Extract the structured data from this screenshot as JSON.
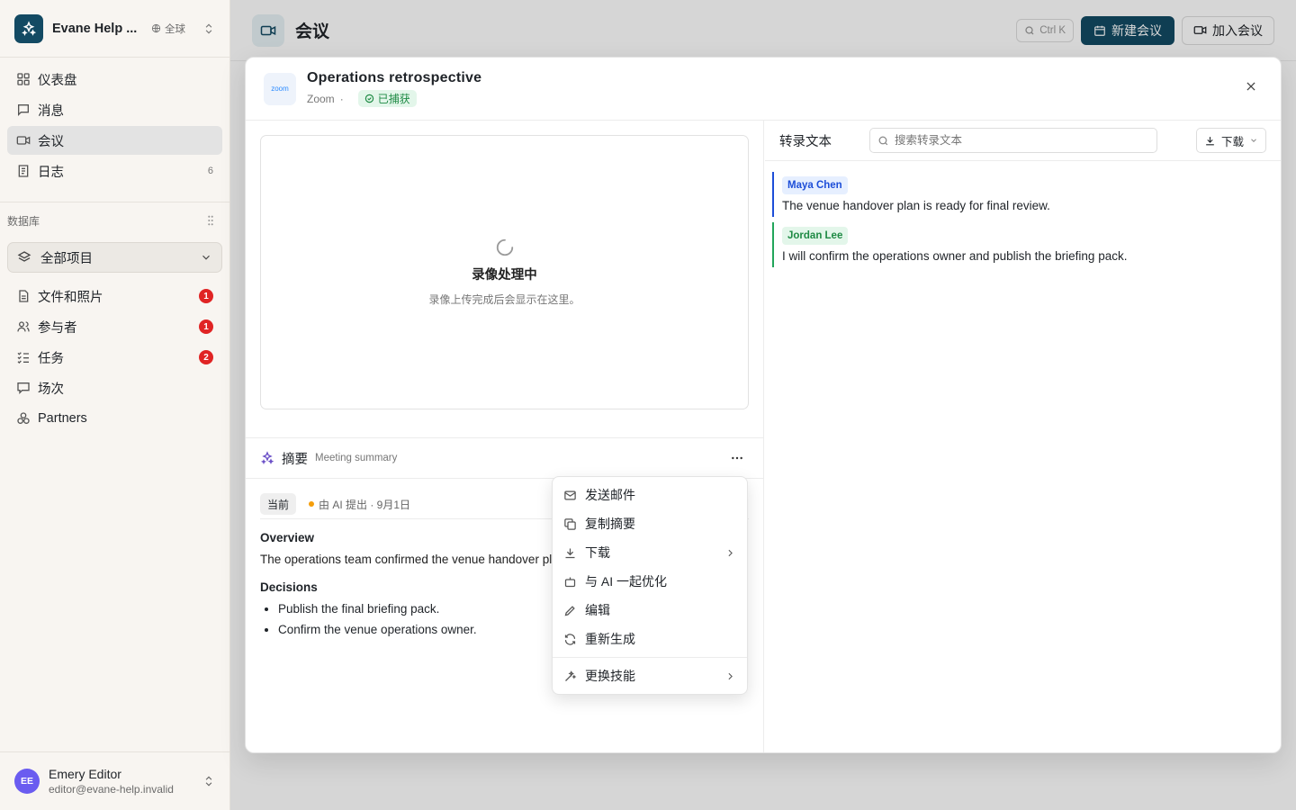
{
  "workspace": {
    "name": "Evane Help ...",
    "scope": "全球"
  },
  "nav": [
    {
      "label": "仪表盘",
      "icon": "dashboard-icon"
    },
    {
      "label": "消息",
      "icon": "message-icon"
    },
    {
      "label": "会议",
      "icon": "video-icon",
      "active": true
    },
    {
      "label": "日志",
      "icon": "log-icon",
      "count": "6"
    }
  ],
  "database": {
    "heading": "数据库",
    "project_select": "全部项目",
    "items": [
      {
        "label": "文件和照片",
        "badge": "1"
      },
      {
        "label": "参与者",
        "badge": "1"
      },
      {
        "label": "任务",
        "badge": "2"
      },
      {
        "label": "场次"
      },
      {
        "label": "Partners"
      }
    ]
  },
  "user": {
    "initials": "EE",
    "name": "Emery Editor",
    "email": "editor@evane-help.invalid"
  },
  "header": {
    "title": "会议",
    "kbd": "Ctrl K",
    "new_meeting": "新建会议",
    "join_meeting": "加入会议"
  },
  "dialog": {
    "logo_text": "zoom",
    "title": "Operations retrospective",
    "platform": "Zoom",
    "separator": "·",
    "status": "已捕获",
    "video": {
      "title": "录像处理中",
      "subtitle": "录像上传完成后会显示在这里。"
    },
    "summary": {
      "label": "摘要",
      "sublabel": "Meeting summary",
      "version_tag": "当前",
      "version_meta": "由 AI 提出 · 9月1日",
      "overview_heading": "Overview",
      "overview_text": "The operations team confirmed the venue handover plan is ready for final review.",
      "decisions_heading": "Decisions",
      "decisions": [
        "Publish the final briefing pack.",
        "Confirm the venue operations owner."
      ]
    },
    "transcript": {
      "title": "转录文本",
      "search_placeholder": "搜索转录文本",
      "download": "下载",
      "entries": [
        {
          "speaker": "Maya Chen",
          "text": "The venue handover plan is ready for final review.",
          "color": "#1d4ed8"
        },
        {
          "speaker": "Jordan Lee",
          "text": "I will confirm the operations owner and publish the briefing pack.",
          "color": "#22a55a"
        }
      ]
    }
  },
  "menu": {
    "items": [
      {
        "label": "发送邮件",
        "icon": "mail-icon"
      },
      {
        "label": "复制摘要",
        "icon": "copy-icon"
      },
      {
        "label": "下载",
        "icon": "download-icon",
        "submenu": true
      },
      {
        "label": "与 AI 一起优化",
        "icon": "bot-icon"
      },
      {
        "label": "编辑",
        "icon": "pencil-icon"
      },
      {
        "label": "重新生成",
        "icon": "refresh-icon"
      }
    ],
    "footer": {
      "label": "更换技能",
      "icon": "wand-icon",
      "submenu": true
    }
  }
}
